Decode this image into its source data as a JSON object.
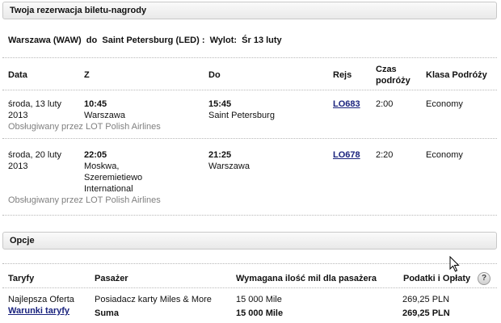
{
  "reservation": {
    "title": "Twoja rezerwacja biletu-nagrody",
    "route": {
      "from": "Warszawa (WAW)",
      "to_word": "do",
      "to": "Saint Petersburg (LED) :",
      "departure_label": "Wylot:",
      "departure_value": "Śr 13 luty"
    },
    "columns": {
      "date": "Data",
      "from": "Z",
      "to": "Do",
      "flight": "Rejs",
      "duration_line1": "Czas",
      "duration_line2": "podróży",
      "class": "Klasa Podróży"
    },
    "flights": [
      {
        "date_line1": "środa, 13 luty",
        "date_line2": "2013",
        "dep_time": "10:45",
        "dep_city": "Warszawa",
        "arr_time": "15:45",
        "arr_city": "Saint Petersburg",
        "flight_no": "LO683",
        "duration": "2:00",
        "class": "Economy",
        "operated": "Obsługiwany przez LOT Polish Airlines"
      },
      {
        "date_line1": "środa, 20 luty",
        "date_line2": "2013",
        "dep_time": "22:05",
        "dep_city_line1": "Moskwa,",
        "dep_city_line2": "Szeremietiewo",
        "dep_city_line3": "International",
        "arr_time": "21:25",
        "arr_city": "Warszawa",
        "flight_no": "LO678",
        "duration": "2:20",
        "class": "Economy",
        "operated": "Obsługiwany przez LOT Polish Airlines"
      }
    ]
  },
  "options": {
    "title": "Opcje",
    "columns": {
      "tariffs": "Taryfy",
      "passenger": "Pasażer",
      "miles_required": "Wymagana ilość mil dla pasażera",
      "taxes": "Podatki i Opłaty",
      "help_icon": "?"
    },
    "row": {
      "tariff": "Najlepsza Oferta",
      "tariff_terms_link": "Warunki taryfy",
      "passenger": "Posiadacz karty Miles & More",
      "miles": "15 000 Mile",
      "taxes": "269,25 PLN"
    },
    "total": {
      "label": "Suma",
      "miles": "15 000 Mile",
      "taxes": "269,25 PLN"
    }
  },
  "icons": {
    "cursor": "mouse-pointer-icon",
    "help": "help-icon"
  }
}
